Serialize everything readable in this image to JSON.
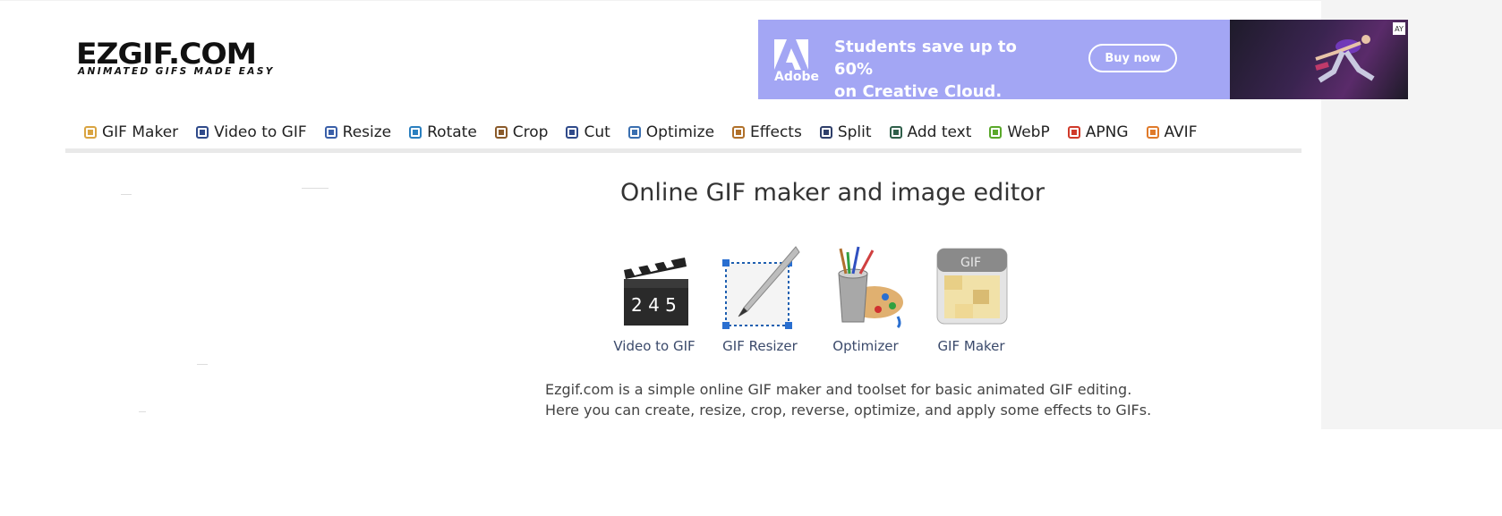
{
  "logo": {
    "main": "EZGIF.COM",
    "tagline": "ANIMATED GIFS MADE EASY"
  },
  "ad": {
    "brand": "Adobe",
    "headline_line1": "Students save up to 60%",
    "headline_line2": "on Creative Cloud.",
    "button": "Buy now",
    "choice_badge": "AY"
  },
  "nav": {
    "items": [
      {
        "label": "GIF Maker",
        "icon": "gif-maker-icon"
      },
      {
        "label": "Video to GIF",
        "icon": "video-icon"
      },
      {
        "label": "Resize",
        "icon": "resize-icon"
      },
      {
        "label": "Rotate",
        "icon": "rotate-icon"
      },
      {
        "label": "Crop",
        "icon": "crop-icon"
      },
      {
        "label": "Cut",
        "icon": "cut-icon"
      },
      {
        "label": "Optimize",
        "icon": "optimize-icon"
      },
      {
        "label": "Effects",
        "icon": "effects-icon"
      },
      {
        "label": "Split",
        "icon": "split-icon"
      },
      {
        "label": "Add text",
        "icon": "add-text-icon"
      },
      {
        "label": "WebP",
        "icon": "webp-icon"
      },
      {
        "label": "APNG",
        "icon": "apng-icon"
      },
      {
        "label": "AVIF",
        "icon": "avif-icon"
      }
    ]
  },
  "main": {
    "title": "Online GIF maker and image editor",
    "tools": [
      {
        "label": "Video to GIF",
        "icon": "clapperboard-icon",
        "digits": "2 4 5"
      },
      {
        "label": "GIF Resizer",
        "icon": "resizer-icon"
      },
      {
        "label": "Optimizer",
        "icon": "paint-bucket-icon"
      },
      {
        "label": "GIF Maker",
        "icon": "gif-file-icon",
        "badge": "GIF"
      }
    ],
    "description_line1": "Ezgif.com is a simple online GIF maker and toolset for basic animated GIF editing.",
    "description_line2": "Here you can create, resize, crop, reverse, optimize, and apply some effects to GIFs."
  },
  "colors": {
    "ad_bg": "#a3a6f4",
    "text": "#333333",
    "link": "#3b4a6b"
  }
}
